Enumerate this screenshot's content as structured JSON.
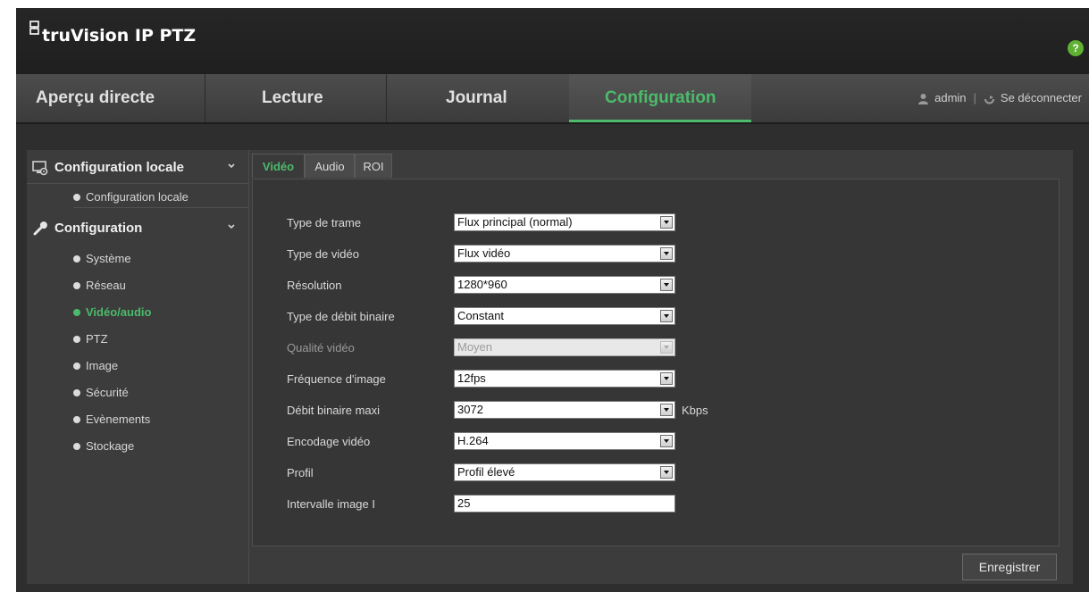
{
  "app": {
    "logo_text": "truVision IP PTZ",
    "help_label": "?",
    "accent_color": "#4cbb6b"
  },
  "nav": {
    "tabs": [
      {
        "label": "Aperçu directe"
      },
      {
        "label": "Lecture"
      },
      {
        "label": "Journal"
      },
      {
        "label": "Configuration"
      }
    ],
    "active_tab": "Configuration",
    "user": "admin",
    "separator": "|",
    "logout": "Se déconnecter"
  },
  "sidebar": {
    "groups": [
      {
        "label": "Configuration locale",
        "icon": "computer-settings-icon",
        "items": [
          "Configuration locale"
        ]
      },
      {
        "label": "Configuration",
        "icon": "wrench-icon",
        "items": [
          "Système",
          "Réseau",
          "Vidéo/audio",
          "PTZ",
          "Image",
          "Sécurité",
          "Evènements",
          "Stockage"
        ]
      }
    ],
    "active_item": "Vidéo/audio"
  },
  "subtabs": [
    {
      "label": "Vidéo"
    },
    {
      "label": "Audio"
    },
    {
      "label": "ROI"
    }
  ],
  "active_subtab": "Vidéo",
  "form": {
    "fields": [
      {
        "label": "Type de trame",
        "value": "Flux principal (normal)"
      },
      {
        "label": "Type de vidéo",
        "value": "Flux vidéo"
      },
      {
        "label": "Résolution",
        "value": "1280*960"
      },
      {
        "label": "Type de débit binaire",
        "value": "Constant"
      },
      {
        "label": "Qualité vidéo",
        "value": "Moyen",
        "disabled": true
      },
      {
        "label": "Fréquence d'image",
        "value": "12fps"
      },
      {
        "label": "Débit binaire maxi",
        "value": "3072",
        "unit": "Kbps"
      },
      {
        "label": "Encodage vidéo",
        "value": "H.264"
      },
      {
        "label": "Profil",
        "value": "Profil élevé"
      },
      {
        "label": "Intervalle image I",
        "value": "25"
      }
    ]
  },
  "save_label": "Enregistrer"
}
